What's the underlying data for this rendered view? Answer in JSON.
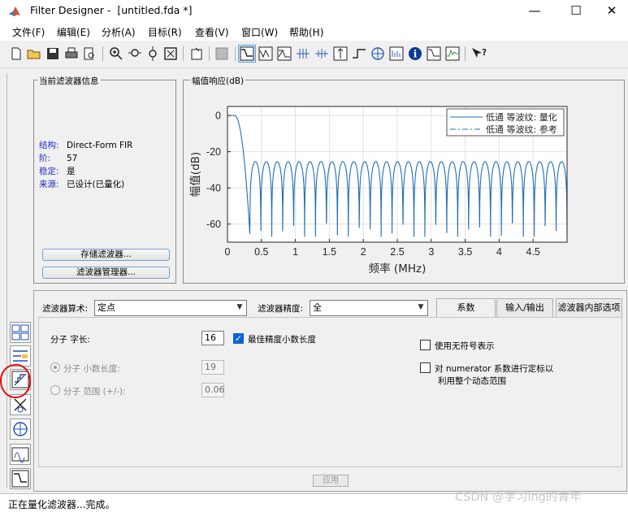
{
  "window": {
    "title": "Filter Designer -  [untitled.fda *]",
    "controls": {
      "minimize": "—",
      "maximize": "☐",
      "close": "✕"
    }
  },
  "menu": [
    "文件(F)",
    "编辑(E)",
    "分析(A)",
    "目标(R)",
    "查看(V)",
    "窗口(W)",
    "帮助(H)"
  ],
  "info_panel": {
    "title": "当前滤波器信息",
    "rows": [
      {
        "key": "结构:",
        "value": "Direct-Form FIR"
      },
      {
        "key": "阶:",
        "value": "57"
      },
      {
        "key": "稳定:",
        "value": "是"
      },
      {
        "key": "来源:",
        "value": "已设计(已量化)"
      }
    ],
    "store_button": "存储滤波器...",
    "manager_button": "滤波器管理器..."
  },
  "plot_panel": {
    "title": "幅值响应(dB)"
  },
  "chart_data": {
    "type": "line",
    "xlabel": "频率 (MHz)",
    "ylabel": "幅值(dB)",
    "xlim": [
      0,
      5
    ],
    "ylim": [
      -70,
      5
    ],
    "xticks": [
      0,
      0.5,
      1,
      1.5,
      2,
      2.5,
      3,
      3.5,
      4,
      4.5
    ],
    "xtick_labels": [
      "0",
      "0.5",
      "1",
      "1.5",
      "2",
      "2.5",
      "3",
      "3.5",
      "4",
      "4.5"
    ],
    "yticks": [
      0,
      -20,
      -40,
      -60
    ],
    "ytick_labels": [
      "0",
      "-20",
      "-40",
      "-60"
    ],
    "grid": true,
    "legend_position": "top-right",
    "series": [
      {
        "name": "低通 等波纹: 量化",
        "style": "solid",
        "color": "#1f6fb5"
      },
      {
        "name": "低通 等波纹: 参考",
        "style": "dashdot",
        "color": "#1f6fb5"
      }
    ],
    "response": {
      "passband_edge": 0.1,
      "stopband_start": 0.33,
      "first_null_depth": -66,
      "stopband_peak": -25.5,
      "lobe_count": 29,
      "null_depth": -67
    }
  },
  "quant_panel": {
    "arith_label": "滤波器算术:",
    "arith_value": "定点",
    "precision_label": "滤波器精度:",
    "precision_value": "全",
    "tabs": [
      "系数",
      "输入/输出",
      "滤波器内部选项"
    ],
    "numerator_wordlength_label": "分子 字长:",
    "numerator_wordlength": "16",
    "best_precision_label": "最佳精度小数长度",
    "fraclength_label": "分子 小数长度:",
    "fraclength": "19",
    "range_label": "分子 范围 (+/-):",
    "range": "0.06",
    "unsigned_label": "使用无符号表示",
    "scale_label_1": "对 numerator 系数进行定标以",
    "scale_label_2": "利用整个动态范围",
    "apply_button": "应用"
  },
  "status": "正在量化滤波器...完成。",
  "watermark": "CSDN @学习ing的青年",
  "colors": {
    "accent": "#0a64d6",
    "annotation": "#e01010",
    "line": "#1f6fb5"
  }
}
